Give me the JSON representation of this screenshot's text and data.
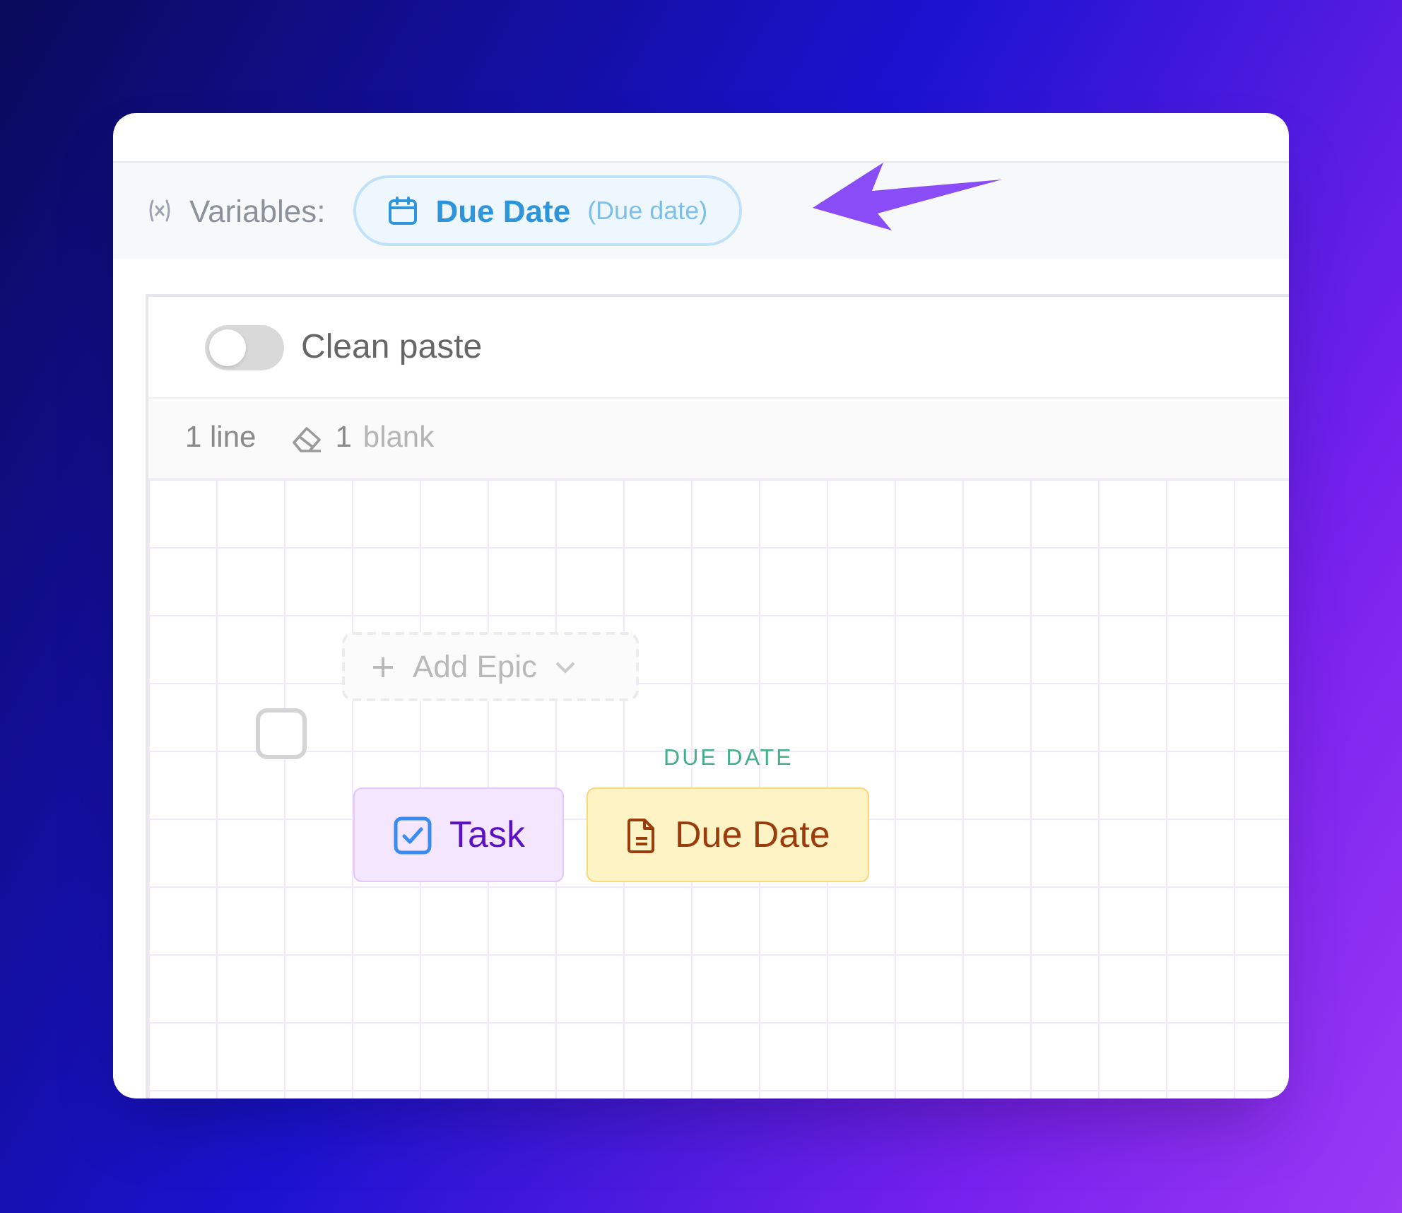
{
  "variables_bar": {
    "label": "Variables:",
    "chip": {
      "name": "Due Date",
      "field": "(Due date)"
    }
  },
  "clean_paste": {
    "label": "Clean paste",
    "on": false
  },
  "stats": {
    "lines": "1 line",
    "blank_count": "1",
    "blank_label": "blank"
  },
  "canvas": {
    "add_epic": "Add Epic",
    "row_checkbox": {
      "checked": false
    },
    "field_caption": "DUE DATE",
    "chips": [
      {
        "kind": "type",
        "label": "Task"
      },
      {
        "kind": "field",
        "label": "Due Date"
      }
    ]
  }
}
